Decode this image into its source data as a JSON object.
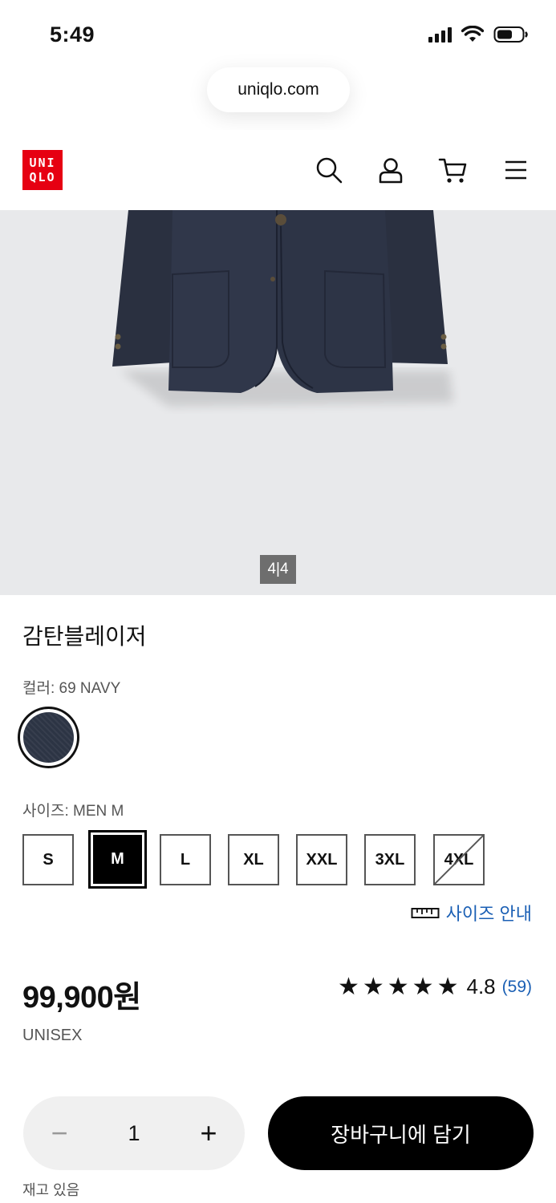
{
  "status_bar": {
    "time": "5:49"
  },
  "browser": {
    "url": "uniqlo.com"
  },
  "header": {
    "logo_top": "UNI",
    "logo_bottom": "QLO",
    "brand_color": "#e60012",
    "icons": [
      "search-icon",
      "account-icon",
      "cart-icon",
      "menu-icon"
    ]
  },
  "gallery": {
    "counter": "4|4",
    "current": 4,
    "total": 4
  },
  "product": {
    "title": "감탄블레이저",
    "color_label": "컬러: 69 NAVY",
    "swatch_color": "#2c3444",
    "size_label": "사이즈: MEN M",
    "sizes": [
      {
        "label": "S",
        "state": "available"
      },
      {
        "label": "M",
        "state": "selected"
      },
      {
        "label": "L",
        "state": "available"
      },
      {
        "label": "XL",
        "state": "available"
      },
      {
        "label": "XXL",
        "state": "available"
      },
      {
        "label": "3XL",
        "state": "available"
      },
      {
        "label": "4XL",
        "state": "unavailable"
      }
    ],
    "size_guide": "사이즈 안내",
    "price": "99,900원",
    "gender": "UNISEX",
    "stars": "★★★★★",
    "rating": "4.8",
    "review_count": "(59)",
    "link_color": "#1a5fb4"
  },
  "actions": {
    "quantity": "1",
    "minus": "−",
    "plus": "+",
    "add_to_cart": "장바구니에 담기",
    "stock_status": "재고 있음"
  }
}
